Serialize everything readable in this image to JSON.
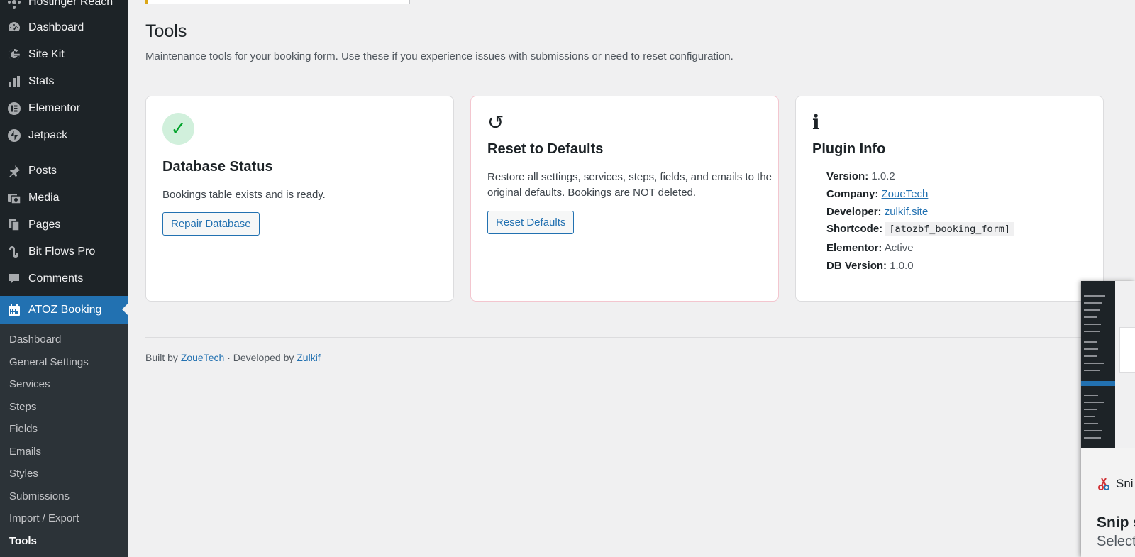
{
  "sidebar": {
    "top_partial": "Hostinger Reach",
    "items": [
      {
        "label": "Dashboard",
        "icon": "dashboard-gauge-icon"
      },
      {
        "label": "Site Kit",
        "icon": "google-g-icon"
      },
      {
        "label": "Stats",
        "icon": "bar-chart-icon"
      },
      {
        "label": "Elementor",
        "icon": "elementor-icon"
      },
      {
        "label": "Jetpack",
        "icon": "jetpack-bolt-icon"
      },
      {
        "label": "Posts",
        "icon": "pushpin-icon"
      },
      {
        "label": "Media",
        "icon": "media-camera-icon"
      },
      {
        "label": "Pages",
        "icon": "pages-icon"
      },
      {
        "label": "Bit Flows Pro",
        "icon": "bitflows-link-icon"
      },
      {
        "label": "Comments",
        "icon": "comment-bubble-icon"
      },
      {
        "label": "ATOZ Booking",
        "icon": "calendar-icon"
      }
    ],
    "submenu": [
      "Dashboard",
      "General Settings",
      "Services",
      "Steps",
      "Fields",
      "Emails",
      "Styles",
      "Submissions",
      "Import / Export",
      "Tools"
    ],
    "current_submenu": "Tools"
  },
  "page": {
    "title": "Tools",
    "description": "Maintenance tools for your booking form. Use these if you experience issues with submissions or need to reset configuration."
  },
  "cards": {
    "db": {
      "icon_glyph": "✓",
      "title": "Database Status",
      "text": "Bookings table exists and is ready.",
      "button": "Repair Database"
    },
    "reset": {
      "icon_glyph": "↺",
      "title": "Reset to Defaults",
      "text_line1": "Restore all settings, services, steps, fields, and emails to the",
      "text_line2": "original defaults. Bookings are NOT deleted.",
      "button": "Reset Defaults"
    },
    "info": {
      "icon_glyph": "i",
      "title": "Plugin Info",
      "version_label": "Version:",
      "version": "1.0.2",
      "company_label": "Company:",
      "company": "ZoueTech",
      "developer_label": "Developer:",
      "developer": "zulkif.site",
      "shortcode_label": "Shortcode:",
      "shortcode": "[atozbf_booking_form]",
      "elementor_label": "Elementor:",
      "elementor": "Active",
      "db_version_label": "DB Version:",
      "db_version": "1.0.0"
    }
  },
  "footer": {
    "built_by": "Built by",
    "company": "ZoueTech",
    "separator": "· Developed by",
    "developer": "Zulkif"
  },
  "snip": {
    "app": "Sni",
    "title": "Snip s",
    "subtitle": "Select"
  },
  "colors": {
    "sidebar_bg": "#1d2327",
    "submenu_bg": "#2c3338",
    "accent": "#2271b1",
    "page_bg": "#f0f0f1",
    "success_bg": "#d1f0dc",
    "success": "#00a32a",
    "danger_border": "#f3c6cf"
  }
}
